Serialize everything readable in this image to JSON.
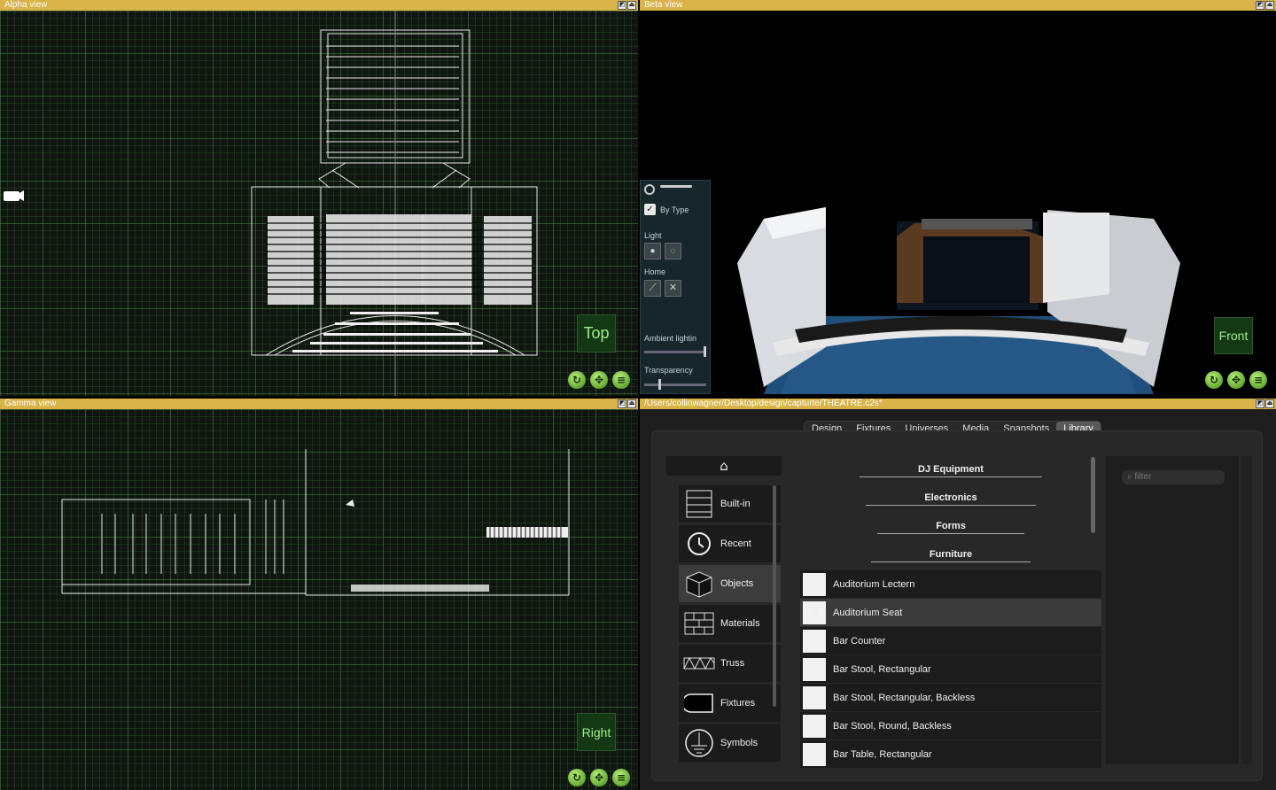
{
  "alpha": {
    "title": "Alpha view",
    "view_label": "Top"
  },
  "beta": {
    "title": "Beta view",
    "view_label": "Front",
    "panel": {
      "by_type": "By Type",
      "by_type_checked": true,
      "light": "Light",
      "home": "Home",
      "ambient": "Ambient lightin",
      "transparency": "Transparency"
    }
  },
  "gamma": {
    "title": "Gamma view",
    "view_label": "Right"
  },
  "library": {
    "title": "/Users/collinwagner/Desktop/design/capturte/THEATRE.c2s*",
    "tabs": [
      "Design",
      "Fixtures",
      "Universes",
      "Media",
      "Snapshots",
      "Library"
    ],
    "selected_tab": "Library",
    "filter_placeholder": "filter",
    "categories": [
      "Built-in",
      "Recent",
      "Objects",
      "Materials",
      "Truss",
      "Fixtures",
      "Symbols"
    ],
    "selected_category": "Objects",
    "sections": [
      "DJ Equipment",
      "Electronics",
      "Forms",
      "Furniture"
    ],
    "items": [
      "Auditorium Lectern",
      "Auditorium Seat",
      "Bar Counter",
      "Bar Stool, Rectangular",
      "Bar Stool, Rectangular, Backless",
      "Bar Stool, Round, Backless",
      "Bar Table, Rectangular"
    ],
    "selected_item": "Auditorium Seat"
  },
  "colors": {
    "titlebar": "#d9b348",
    "grid_bg": "#0f150f",
    "badge_text": "#9ef08a"
  }
}
